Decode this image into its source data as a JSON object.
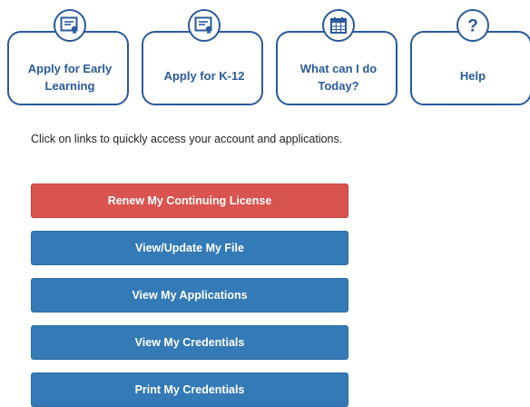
{
  "tiles": [
    {
      "label": "Apply for Early Learning",
      "icon": "certificate-icon"
    },
    {
      "label": "Apply for K-12",
      "icon": "certificate-icon"
    },
    {
      "label": "What can I do Today?",
      "icon": "calendar-icon"
    },
    {
      "label": "Help",
      "icon": "question-icon"
    }
  ],
  "intro": "Click on links to quickly access your account and applications.",
  "buttons": [
    {
      "label": "Renew My Continuing License",
      "color": "#d9534f"
    },
    {
      "label": "View/Update My File",
      "color": "#337ab7"
    },
    {
      "label": "View My Applications",
      "color": "#337ab7"
    },
    {
      "label": "View My Credentials",
      "color": "#337ab7"
    },
    {
      "label": "Print My Credentials",
      "color": "#337ab7"
    }
  ],
  "colors": {
    "accent": "#2a5a9a"
  }
}
